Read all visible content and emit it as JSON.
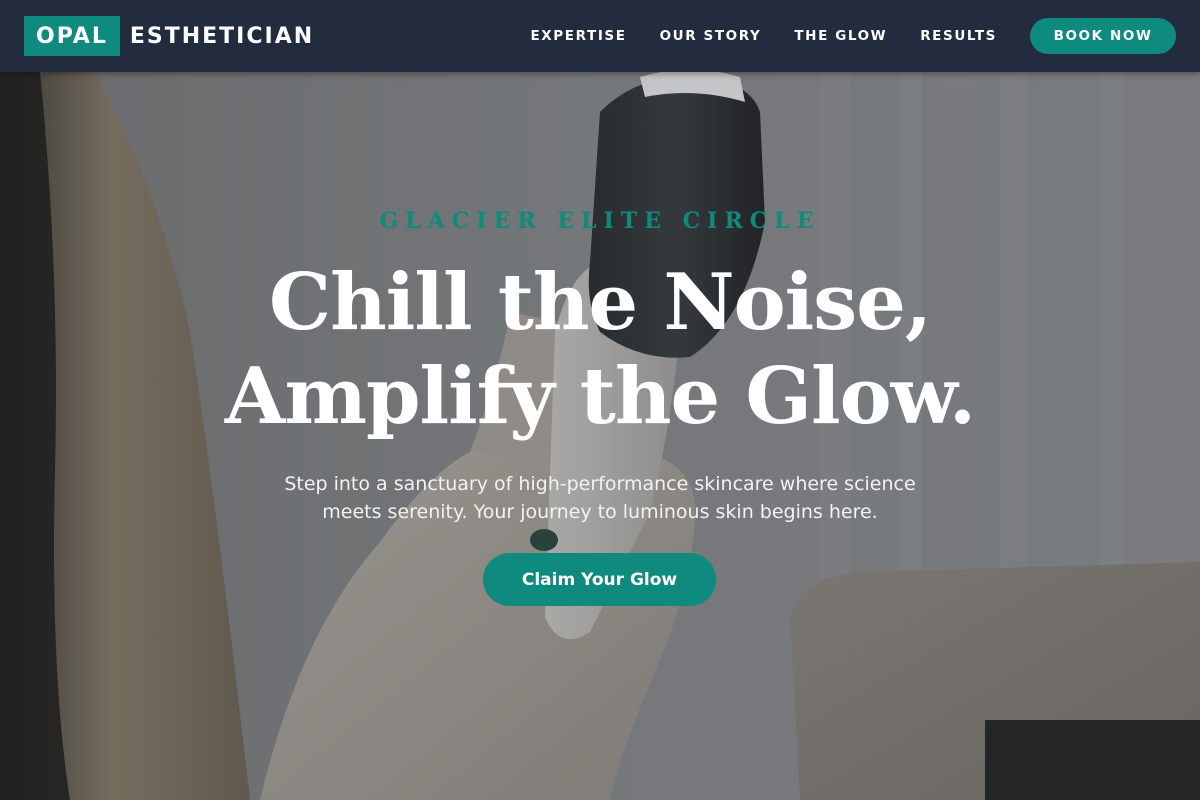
{
  "brand": {
    "logo_box": "OPAL",
    "logo_text": "ESTHETICIAN"
  },
  "nav": {
    "links": [
      "EXPERTISE",
      "OUR STORY",
      "THE GLOW",
      "RESULTS"
    ],
    "cta": "BOOK NOW"
  },
  "hero": {
    "eyebrow": "GLACIER ELITE CIRCLE",
    "headline_line1": "Chill the Noise,",
    "headline_line2": "Amplify the Glow.",
    "subtext_line1": "Step into a sanctuary of high-performance skincare where science",
    "subtext_line2": "meets serenity. Your journey to luminous skin begins here.",
    "cta": "Claim Your Glow",
    "image_subject": "gloved-hand-holding-skincare-device"
  },
  "colors": {
    "accent": "#0e8a7e",
    "header_bg": "#222c3e",
    "text_light": "#ffffff"
  }
}
